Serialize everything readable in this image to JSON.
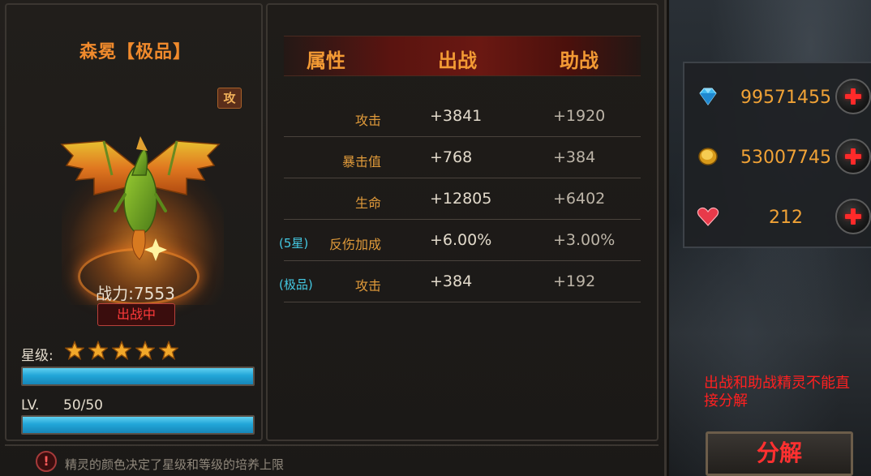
{
  "spirit": {
    "name": "森冕【极品】",
    "type_badge": "攻",
    "power": "战力:7553",
    "status": "出战中",
    "star_label": "星级:",
    "stars": 5,
    "star_bar_fill": 1.0,
    "level_label": "LV.",
    "level_value": "50/50",
    "level_bar_fill": 1.0
  },
  "stats": {
    "headers": {
      "attr": "属性",
      "deploy": "出战",
      "assist": "助战"
    },
    "rows": [
      {
        "tag": "",
        "name": "攻击",
        "deploy": "+3841",
        "assist": "+1920"
      },
      {
        "tag": "",
        "name": "暴击值",
        "deploy": "+768",
        "assist": "+384"
      },
      {
        "tag": "",
        "name": "生命",
        "deploy": "+12805",
        "assist": "+6402"
      },
      {
        "tag": "(5星)",
        "name": "反伤加成",
        "deploy": "+6.00%",
        "assist": "+3.00%"
      },
      {
        "tag": "(极品)",
        "name": "攻击",
        "deploy": "+384",
        "assist": "+192"
      }
    ]
  },
  "tip": {
    "icon": "exclamation-icon",
    "text": "精灵的颜色决定了星级和等级的培养上限"
  },
  "currency": [
    {
      "icon": "diamond-icon",
      "value": "99571455"
    },
    {
      "icon": "gold-coin-icon",
      "value": "53007745"
    },
    {
      "icon": "heart-icon",
      "value": "212"
    }
  ],
  "warning": "出战和助战精灵不能直接分解",
  "decompose_label": "分解",
  "colors": {
    "accent": "#f08a2c",
    "warning": "#ff2020",
    "bar": "#22a6d8"
  }
}
